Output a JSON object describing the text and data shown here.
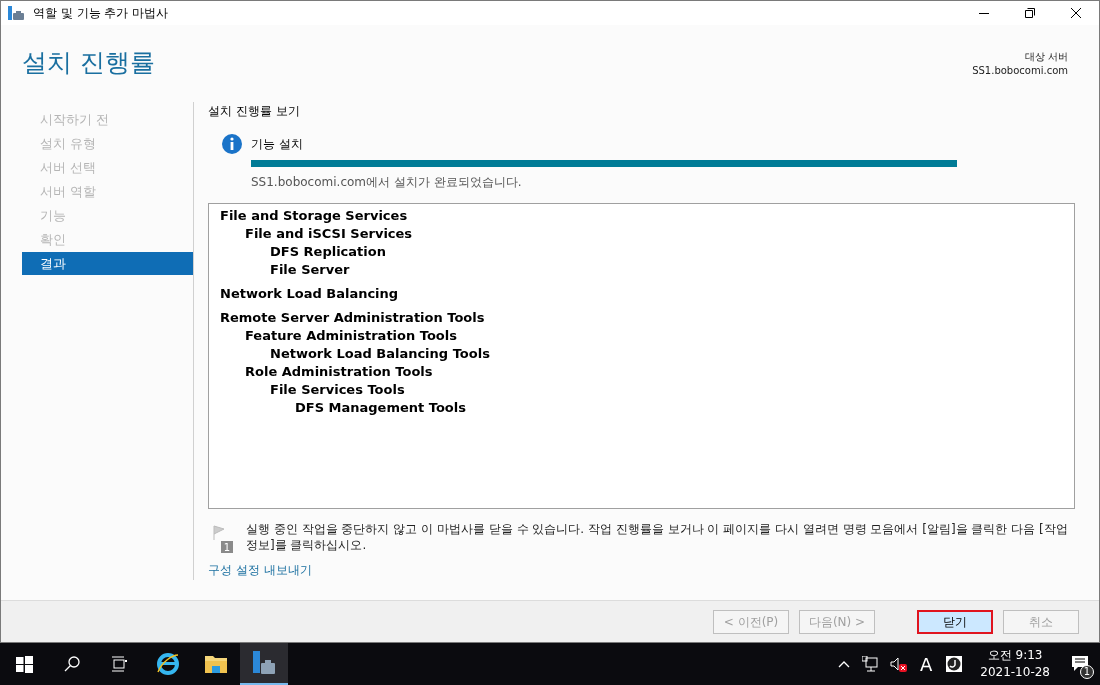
{
  "window": {
    "title": "역할 및 기능 추가 마법사"
  },
  "header": {
    "title": "설치 진행률",
    "target_label": "대상 서버",
    "target_value": "SS1.bobocomi.com"
  },
  "steps": [
    {
      "label": "시작하기 전",
      "selected": false
    },
    {
      "label": "설치 유형",
      "selected": false
    },
    {
      "label": "서버 선택",
      "selected": false
    },
    {
      "label": "서버 역할",
      "selected": false
    },
    {
      "label": "기능",
      "selected": false
    },
    {
      "label": "확인",
      "selected": false
    },
    {
      "label": "결과",
      "selected": true
    }
  ],
  "progress": {
    "heading": "설치 진행률 보기",
    "status": "기능 설치",
    "level": 1,
    "message": "SS1.bobocomi.com에서 설치가 완료되었습니다."
  },
  "results": [
    {
      "label": "File and Storage Services",
      "children": [
        {
          "label": "File and iSCSI Services",
          "children": [
            {
              "label": "DFS Replication"
            },
            {
              "label": "File Server"
            }
          ]
        }
      ]
    },
    {
      "label": "Network Load Balancing"
    },
    {
      "label": "Remote Server Administration Tools",
      "children": [
        {
          "label": "Feature Administration Tools",
          "children": [
            {
              "label": "Network Load Balancing Tools"
            }
          ]
        },
        {
          "label": "Role Administration Tools",
          "children": [
            {
              "label": "File Services Tools",
              "children": [
                {
                  "label": "DFS Management Tools"
                }
              ]
            }
          ]
        }
      ]
    }
  ],
  "note": {
    "badge": "1",
    "text": "실행 중인 작업을 중단하지 않고 이 마법사를 닫을 수 있습니다. 작업 진행률을 보거나 이 페이지를 다시 열려면 명령 모음에서 [알림]을 클릭한 다음 [작업 정보]를 클릭하십시오."
  },
  "export_link": "구성 설정 내보내기",
  "buttons": [
    {
      "label": "< 이전(P)",
      "disabled": true,
      "focused": false
    },
    {
      "label": "다음(N) >",
      "disabled": true,
      "focused": false
    },
    {
      "label": "닫기",
      "disabled": false,
      "focused": true
    },
    {
      "label": "취소",
      "disabled": true,
      "focused": false
    }
  ],
  "taskbar": {
    "input_indicator": "A",
    "time": "오전 9:13",
    "date": "2021-10-28",
    "notification_count": "1"
  }
}
